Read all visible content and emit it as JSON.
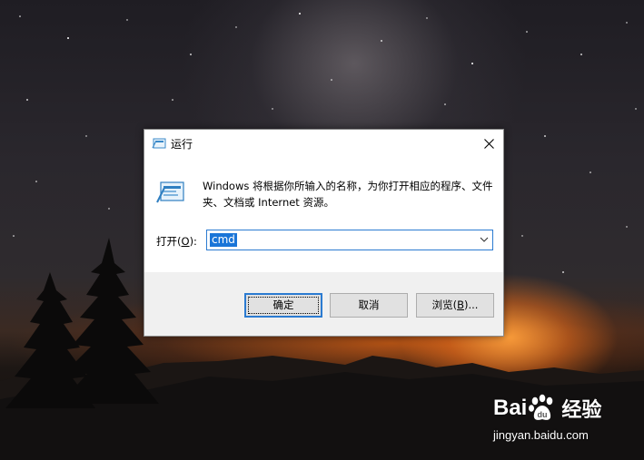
{
  "dialog": {
    "title": "运行",
    "description": "Windows 将根据你所输入的名称，为你打开相应的程序、文件夹、文档或 Internet 资源。",
    "open_label": "打开(",
    "open_mnemonic": "O",
    "open_label_end": "):",
    "command_value": "cmd",
    "buttons": {
      "ok": "确定",
      "cancel": "取消",
      "browse": "浏览(",
      "browse_mnemonic": "B",
      "browse_end": ")..."
    }
  },
  "watermark": {
    "brand_left": "Bai",
    "brand_right": "经验",
    "url": "jingyan.baidu.com"
  },
  "colors": {
    "accent": "#2b7bd1",
    "selection": "#1a75d8",
    "footer_bg": "#f0f0f0",
    "button_bg": "#e1e1e1"
  },
  "icons": [
    "run-program-icon",
    "close-icon",
    "chevron-down-icon",
    "baidu-paw-icon"
  ]
}
